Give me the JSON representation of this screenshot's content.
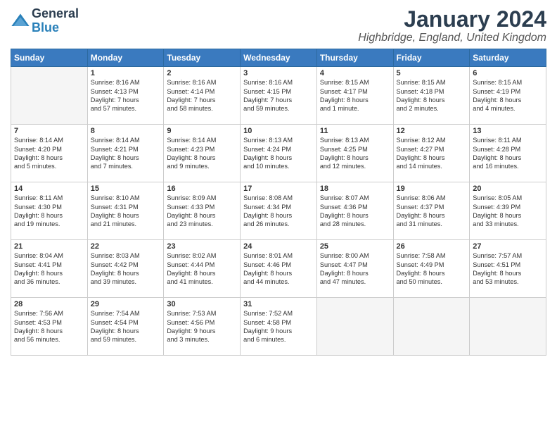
{
  "header": {
    "logo_general": "General",
    "logo_blue": "Blue",
    "month_title": "January 2024",
    "location": "Highbridge, England, United Kingdom"
  },
  "weekdays": [
    "Sunday",
    "Monday",
    "Tuesday",
    "Wednesday",
    "Thursday",
    "Friday",
    "Saturday"
  ],
  "weeks": [
    [
      {
        "day": "",
        "content": ""
      },
      {
        "day": "1",
        "content": "Sunrise: 8:16 AM\nSunset: 4:13 PM\nDaylight: 7 hours\nand 57 minutes."
      },
      {
        "day": "2",
        "content": "Sunrise: 8:16 AM\nSunset: 4:14 PM\nDaylight: 7 hours\nand 58 minutes."
      },
      {
        "day": "3",
        "content": "Sunrise: 8:16 AM\nSunset: 4:15 PM\nDaylight: 7 hours\nand 59 minutes."
      },
      {
        "day": "4",
        "content": "Sunrise: 8:15 AM\nSunset: 4:17 PM\nDaylight: 8 hours\nand 1 minute."
      },
      {
        "day": "5",
        "content": "Sunrise: 8:15 AM\nSunset: 4:18 PM\nDaylight: 8 hours\nand 2 minutes."
      },
      {
        "day": "6",
        "content": "Sunrise: 8:15 AM\nSunset: 4:19 PM\nDaylight: 8 hours\nand 4 minutes."
      }
    ],
    [
      {
        "day": "7",
        "content": "Sunrise: 8:14 AM\nSunset: 4:20 PM\nDaylight: 8 hours\nand 5 minutes."
      },
      {
        "day": "8",
        "content": "Sunrise: 8:14 AM\nSunset: 4:21 PM\nDaylight: 8 hours\nand 7 minutes."
      },
      {
        "day": "9",
        "content": "Sunrise: 8:14 AM\nSunset: 4:23 PM\nDaylight: 8 hours\nand 9 minutes."
      },
      {
        "day": "10",
        "content": "Sunrise: 8:13 AM\nSunset: 4:24 PM\nDaylight: 8 hours\nand 10 minutes."
      },
      {
        "day": "11",
        "content": "Sunrise: 8:13 AM\nSunset: 4:25 PM\nDaylight: 8 hours\nand 12 minutes."
      },
      {
        "day": "12",
        "content": "Sunrise: 8:12 AM\nSunset: 4:27 PM\nDaylight: 8 hours\nand 14 minutes."
      },
      {
        "day": "13",
        "content": "Sunrise: 8:11 AM\nSunset: 4:28 PM\nDaylight: 8 hours\nand 16 minutes."
      }
    ],
    [
      {
        "day": "14",
        "content": "Sunrise: 8:11 AM\nSunset: 4:30 PM\nDaylight: 8 hours\nand 19 minutes."
      },
      {
        "day": "15",
        "content": "Sunrise: 8:10 AM\nSunset: 4:31 PM\nDaylight: 8 hours\nand 21 minutes."
      },
      {
        "day": "16",
        "content": "Sunrise: 8:09 AM\nSunset: 4:33 PM\nDaylight: 8 hours\nand 23 minutes."
      },
      {
        "day": "17",
        "content": "Sunrise: 8:08 AM\nSunset: 4:34 PM\nDaylight: 8 hours\nand 26 minutes."
      },
      {
        "day": "18",
        "content": "Sunrise: 8:07 AM\nSunset: 4:36 PM\nDaylight: 8 hours\nand 28 minutes."
      },
      {
        "day": "19",
        "content": "Sunrise: 8:06 AM\nSunset: 4:37 PM\nDaylight: 8 hours\nand 31 minutes."
      },
      {
        "day": "20",
        "content": "Sunrise: 8:05 AM\nSunset: 4:39 PM\nDaylight: 8 hours\nand 33 minutes."
      }
    ],
    [
      {
        "day": "21",
        "content": "Sunrise: 8:04 AM\nSunset: 4:41 PM\nDaylight: 8 hours\nand 36 minutes."
      },
      {
        "day": "22",
        "content": "Sunrise: 8:03 AM\nSunset: 4:42 PM\nDaylight: 8 hours\nand 39 minutes."
      },
      {
        "day": "23",
        "content": "Sunrise: 8:02 AM\nSunset: 4:44 PM\nDaylight: 8 hours\nand 41 minutes."
      },
      {
        "day": "24",
        "content": "Sunrise: 8:01 AM\nSunset: 4:46 PM\nDaylight: 8 hours\nand 44 minutes."
      },
      {
        "day": "25",
        "content": "Sunrise: 8:00 AM\nSunset: 4:47 PM\nDaylight: 8 hours\nand 47 minutes."
      },
      {
        "day": "26",
        "content": "Sunrise: 7:58 AM\nSunset: 4:49 PM\nDaylight: 8 hours\nand 50 minutes."
      },
      {
        "day": "27",
        "content": "Sunrise: 7:57 AM\nSunset: 4:51 PM\nDaylight: 8 hours\nand 53 minutes."
      }
    ],
    [
      {
        "day": "28",
        "content": "Sunrise: 7:56 AM\nSunset: 4:53 PM\nDaylight: 8 hours\nand 56 minutes."
      },
      {
        "day": "29",
        "content": "Sunrise: 7:54 AM\nSunset: 4:54 PM\nDaylight: 8 hours\nand 59 minutes."
      },
      {
        "day": "30",
        "content": "Sunrise: 7:53 AM\nSunset: 4:56 PM\nDaylight: 9 hours\nand 3 minutes."
      },
      {
        "day": "31",
        "content": "Sunrise: 7:52 AM\nSunset: 4:58 PM\nDaylight: 9 hours\nand 6 minutes."
      },
      {
        "day": "",
        "content": ""
      },
      {
        "day": "",
        "content": ""
      },
      {
        "day": "",
        "content": ""
      }
    ]
  ]
}
